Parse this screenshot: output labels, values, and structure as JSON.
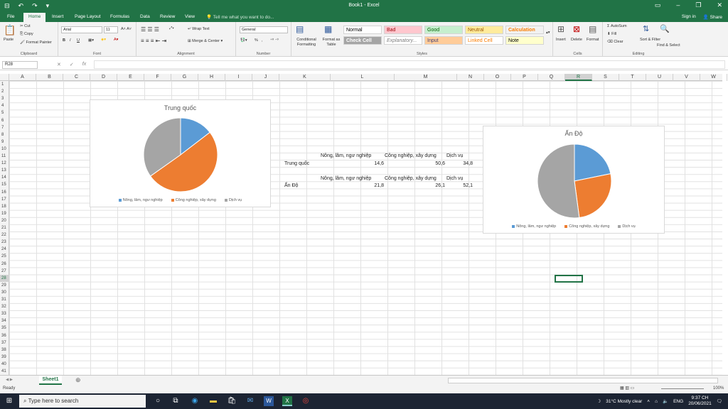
{
  "titlebar": {
    "document_title": "Book1 - Excel",
    "quick_access": [
      "⊟",
      "↶",
      "↷",
      "▾"
    ],
    "window_controls": [
      "▭",
      "–",
      "❐",
      "✕"
    ]
  },
  "tabs": {
    "items": [
      "File",
      "Home",
      "Insert",
      "Page Layout",
      "Formulas",
      "Data",
      "Review",
      "View"
    ],
    "tell_me": "Tell me what you want to do...",
    "sign_in": "Sign in",
    "share": "Share"
  },
  "ribbon": {
    "clipboard": {
      "paste": "Paste",
      "cut": "Cut",
      "copy": "Copy",
      "format_painter": "Format Painter",
      "label": "Clipboard"
    },
    "font": {
      "name": "Arial",
      "size": "11",
      "label": "Font",
      "bold": "B",
      "italic": "I",
      "underline": "U"
    },
    "alignment": {
      "wrap_text": "Wrap Text",
      "merge_center": "Merge & Center",
      "label": "Alignment"
    },
    "number": {
      "format": "General",
      "percent": "%",
      "comma": ",",
      "label": "Number"
    },
    "styles": {
      "conditional": "Conditional Formatting",
      "format_table": "Format as Table",
      "label": "Styles",
      "cells": [
        {
          "text": "Normal",
          "bg": "#ffffff",
          "color": "#000000"
        },
        {
          "text": "Bad",
          "bg": "#ffc7ce",
          "color": "#9c0006"
        },
        {
          "text": "Good",
          "bg": "#c6efce",
          "color": "#006100"
        },
        {
          "text": "Neutral",
          "bg": "#ffeb9c",
          "color": "#9c5700"
        },
        {
          "text": "Calculation",
          "bg": "#f2f2f2",
          "color": "#fa7d00"
        },
        {
          "text": "Check Cell",
          "bg": "#a5a5a5",
          "color": "#ffffff"
        },
        {
          "text": "Explanatory...",
          "bg": "#ffffff",
          "color": "#7f7f7f"
        },
        {
          "text": "Input",
          "bg": "#ffcc99",
          "color": "#3f3f76"
        },
        {
          "text": "Linked Cell",
          "bg": "#ffffff",
          "color": "#fa7d00"
        },
        {
          "text": "Note",
          "bg": "#ffffcc",
          "color": "#000000"
        }
      ]
    },
    "cells": {
      "insert": "Insert",
      "delete": "Delete",
      "format": "Format",
      "label": "Cells"
    },
    "editing": {
      "autosum": "AutoSum",
      "fill": "Fill",
      "clear": "Clear",
      "sort_filter": "Sort & Filter",
      "find_select": "Find & Select",
      "label": "Editing"
    }
  },
  "formula_bar": {
    "name_box": "R28",
    "formula": ""
  },
  "columns": [
    "A",
    "B",
    "C",
    "D",
    "E",
    "F",
    "G",
    "H",
    "I",
    "J",
    "K",
    "L",
    "M",
    "N",
    "O",
    "P",
    "Q",
    "R",
    "S",
    "T",
    "U",
    "V",
    "W"
  ],
  "rows": [
    "1",
    "2",
    "3",
    "4",
    "5",
    "6",
    "7",
    "8",
    "9",
    "10",
    "11",
    "12",
    "13",
    "14",
    "15",
    "16",
    "17",
    "18",
    "19",
    "20",
    "21",
    "22",
    "23",
    "24",
    "25",
    "26",
    "27",
    "28",
    "29",
    "30",
    "31",
    "32",
    "33",
    "34",
    "35",
    "36",
    "37",
    "38",
    "39",
    "40",
    "41"
  ],
  "selected_cell": "R28",
  "cells": {
    "r11_l": "Nông, lâm, ngư nghiệp",
    "r11_m": "Công nghiệp, xây dựng",
    "r11_n": "Dịch vụ",
    "r12_k": "Trung quốc",
    "r12_l": "14,6",
    "r12_m": "50,6",
    "r12_n": "34,8",
    "r14_l": "Nông, lâm, ngư nghiệp",
    "r14_m": "Công nghiệp, xây dựng",
    "r14_n": "Dịch vụ",
    "r15_k": "Ấn Độ",
    "r15_l": "21,8",
    "r15_m": "26,1",
    "r15_n": "52,1"
  },
  "chart_data": [
    {
      "type": "pie",
      "title": "Trung quốc",
      "categories": [
        "Nông, lâm, ngư nghiệp",
        "Công nghiệp, xây dựng",
        "Dịch vụ"
      ],
      "values": [
        14.6,
        50.6,
        34.8
      ],
      "colors": [
        "#5b9bd5",
        "#ed7d31",
        "#a5a5a5"
      ],
      "legend": "bottom"
    },
    {
      "type": "pie",
      "title": "Ấn Độ",
      "categories": [
        "Nông, lâm, ngư nghiệp",
        "Công nghiệp, xây dựng",
        "Dịch vụ"
      ],
      "values": [
        21.8,
        26.1,
        52.1
      ],
      "colors": [
        "#5b9bd5",
        "#ed7d31",
        "#a5a5a5"
      ],
      "legend": "bottom"
    }
  ],
  "sheets": {
    "active": "Sheet1",
    "add": "⊕"
  },
  "status": {
    "ready": "Ready",
    "zoom": "100%"
  },
  "taskbar": {
    "search_placeholder": "Type here to search",
    "weather": "31°C  Mostly clear",
    "lang": "ENG",
    "time": "9:37 CH",
    "date": "20/06/2021"
  }
}
